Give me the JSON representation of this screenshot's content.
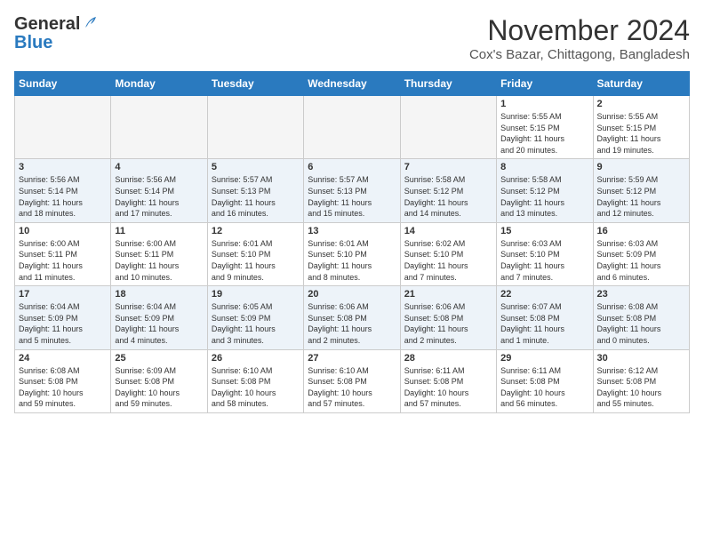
{
  "header": {
    "logo_general": "General",
    "logo_blue": "Blue",
    "month_title": "November 2024",
    "location": "Cox's Bazar, Chittagong, Bangladesh"
  },
  "days_of_week": [
    "Sunday",
    "Monday",
    "Tuesday",
    "Wednesday",
    "Thursday",
    "Friday",
    "Saturday"
  ],
  "weeks": [
    [
      {
        "day": "",
        "info": ""
      },
      {
        "day": "",
        "info": ""
      },
      {
        "day": "",
        "info": ""
      },
      {
        "day": "",
        "info": ""
      },
      {
        "day": "",
        "info": ""
      },
      {
        "day": "1",
        "info": "Sunrise: 5:55 AM\nSunset: 5:15 PM\nDaylight: 11 hours\nand 20 minutes."
      },
      {
        "day": "2",
        "info": "Sunrise: 5:55 AM\nSunset: 5:15 PM\nDaylight: 11 hours\nand 19 minutes."
      }
    ],
    [
      {
        "day": "3",
        "info": "Sunrise: 5:56 AM\nSunset: 5:14 PM\nDaylight: 11 hours\nand 18 minutes."
      },
      {
        "day": "4",
        "info": "Sunrise: 5:56 AM\nSunset: 5:14 PM\nDaylight: 11 hours\nand 17 minutes."
      },
      {
        "day": "5",
        "info": "Sunrise: 5:57 AM\nSunset: 5:13 PM\nDaylight: 11 hours\nand 16 minutes."
      },
      {
        "day": "6",
        "info": "Sunrise: 5:57 AM\nSunset: 5:13 PM\nDaylight: 11 hours\nand 15 minutes."
      },
      {
        "day": "7",
        "info": "Sunrise: 5:58 AM\nSunset: 5:12 PM\nDaylight: 11 hours\nand 14 minutes."
      },
      {
        "day": "8",
        "info": "Sunrise: 5:58 AM\nSunset: 5:12 PM\nDaylight: 11 hours\nand 13 minutes."
      },
      {
        "day": "9",
        "info": "Sunrise: 5:59 AM\nSunset: 5:12 PM\nDaylight: 11 hours\nand 12 minutes."
      }
    ],
    [
      {
        "day": "10",
        "info": "Sunrise: 6:00 AM\nSunset: 5:11 PM\nDaylight: 11 hours\nand 11 minutes."
      },
      {
        "day": "11",
        "info": "Sunrise: 6:00 AM\nSunset: 5:11 PM\nDaylight: 11 hours\nand 10 minutes."
      },
      {
        "day": "12",
        "info": "Sunrise: 6:01 AM\nSunset: 5:10 PM\nDaylight: 11 hours\nand 9 minutes."
      },
      {
        "day": "13",
        "info": "Sunrise: 6:01 AM\nSunset: 5:10 PM\nDaylight: 11 hours\nand 8 minutes."
      },
      {
        "day": "14",
        "info": "Sunrise: 6:02 AM\nSunset: 5:10 PM\nDaylight: 11 hours\nand 7 minutes."
      },
      {
        "day": "15",
        "info": "Sunrise: 6:03 AM\nSunset: 5:10 PM\nDaylight: 11 hours\nand 7 minutes."
      },
      {
        "day": "16",
        "info": "Sunrise: 6:03 AM\nSunset: 5:09 PM\nDaylight: 11 hours\nand 6 minutes."
      }
    ],
    [
      {
        "day": "17",
        "info": "Sunrise: 6:04 AM\nSunset: 5:09 PM\nDaylight: 11 hours\nand 5 minutes."
      },
      {
        "day": "18",
        "info": "Sunrise: 6:04 AM\nSunset: 5:09 PM\nDaylight: 11 hours\nand 4 minutes."
      },
      {
        "day": "19",
        "info": "Sunrise: 6:05 AM\nSunset: 5:09 PM\nDaylight: 11 hours\nand 3 minutes."
      },
      {
        "day": "20",
        "info": "Sunrise: 6:06 AM\nSunset: 5:08 PM\nDaylight: 11 hours\nand 2 minutes."
      },
      {
        "day": "21",
        "info": "Sunrise: 6:06 AM\nSunset: 5:08 PM\nDaylight: 11 hours\nand 2 minutes."
      },
      {
        "day": "22",
        "info": "Sunrise: 6:07 AM\nSunset: 5:08 PM\nDaylight: 11 hours\nand 1 minute."
      },
      {
        "day": "23",
        "info": "Sunrise: 6:08 AM\nSunset: 5:08 PM\nDaylight: 11 hours\nand 0 minutes."
      }
    ],
    [
      {
        "day": "24",
        "info": "Sunrise: 6:08 AM\nSunset: 5:08 PM\nDaylight: 10 hours\nand 59 minutes."
      },
      {
        "day": "25",
        "info": "Sunrise: 6:09 AM\nSunset: 5:08 PM\nDaylight: 10 hours\nand 59 minutes."
      },
      {
        "day": "26",
        "info": "Sunrise: 6:10 AM\nSunset: 5:08 PM\nDaylight: 10 hours\nand 58 minutes."
      },
      {
        "day": "27",
        "info": "Sunrise: 6:10 AM\nSunset: 5:08 PM\nDaylight: 10 hours\nand 57 minutes."
      },
      {
        "day": "28",
        "info": "Sunrise: 6:11 AM\nSunset: 5:08 PM\nDaylight: 10 hours\nand 57 minutes."
      },
      {
        "day": "29",
        "info": "Sunrise: 6:11 AM\nSunset: 5:08 PM\nDaylight: 10 hours\nand 56 minutes."
      },
      {
        "day": "30",
        "info": "Sunrise: 6:12 AM\nSunset: 5:08 PM\nDaylight: 10 hours\nand 55 minutes."
      }
    ]
  ]
}
